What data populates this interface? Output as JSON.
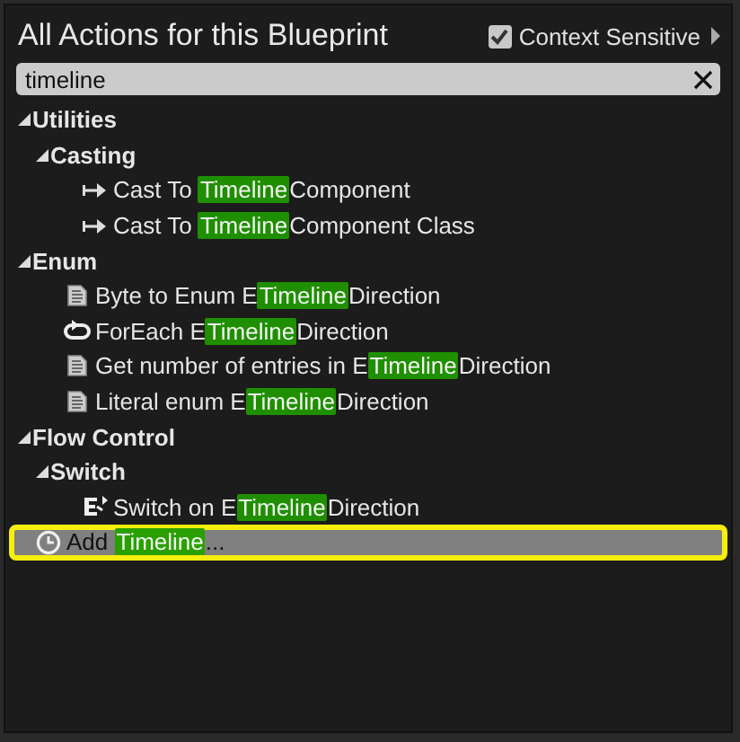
{
  "window": {
    "title": "All Actions for this Blueprint"
  },
  "context_sensitive": {
    "label": "Context Sensitive",
    "checked": true
  },
  "search": {
    "value": "timeline"
  },
  "tree": [
    {
      "label": "Utilities",
      "expanded": true,
      "children": [
        {
          "label": "Casting",
          "expanded": true,
          "children": [
            {
              "kind": "cast",
              "before": "Cast To ",
              "match": "Timeline",
              "after": "Component",
              "selected": false
            },
            {
              "kind": "cast",
              "before": "Cast To ",
              "match": "Timeline",
              "after": "Component Class",
              "selected": false
            }
          ]
        }
      ]
    },
    {
      "label": "Enum",
      "expanded": true,
      "children": [
        {
          "kind": "enum",
          "before": "Byte to Enum E",
          "match": "Timeline",
          "after": "Direction",
          "selected": false
        },
        {
          "kind": "loop",
          "before": "ForEach E",
          "match": "Timeline",
          "after": "Direction",
          "selected": false
        },
        {
          "kind": "enum",
          "before": "Get number of entries in E",
          "match": "Timeline",
          "after": "Direction",
          "selected": false
        },
        {
          "kind": "enum",
          "before": "Literal enum E",
          "match": "Timeline",
          "after": "Direction",
          "selected": false
        }
      ]
    },
    {
      "label": "Flow Control",
      "expanded": true,
      "children": [
        {
          "label": "Switch",
          "expanded": true,
          "children": [
            {
              "kind": "switch",
              "before": "Switch on E",
              "match": "Timeline",
              "after": "Direction",
              "selected": false
            }
          ]
        }
      ]
    },
    {
      "kind": "timeline",
      "before": "Add ",
      "match": "Timeline",
      "after": "...",
      "selected": true
    }
  ]
}
